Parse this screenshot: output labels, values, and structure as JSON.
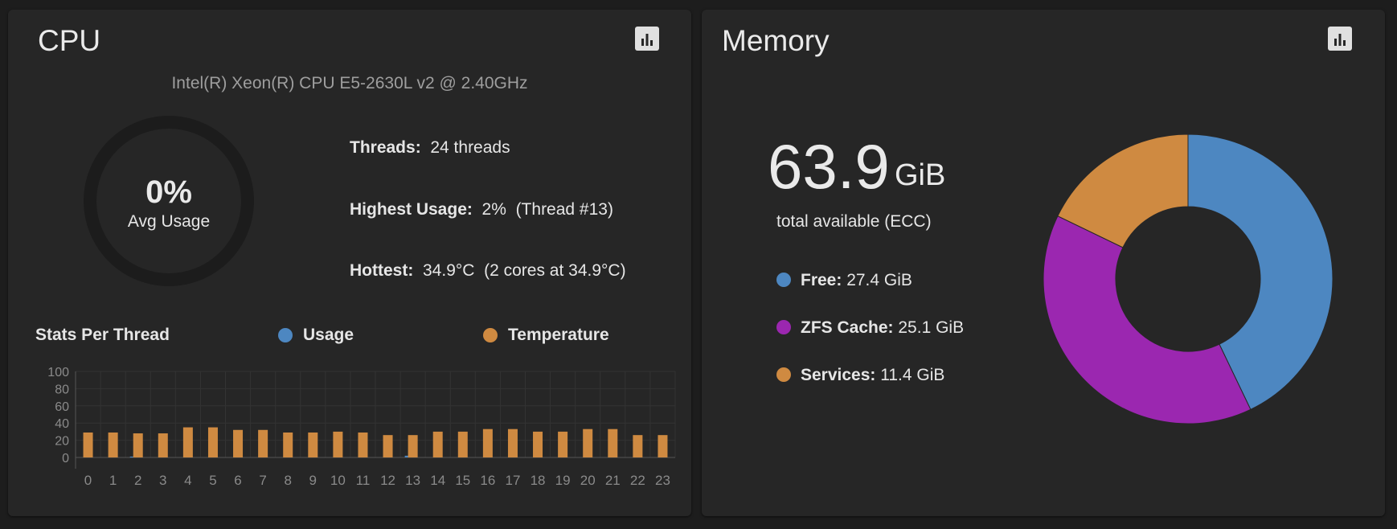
{
  "cpu": {
    "title": "CPU",
    "model": "Intel(R) Xeon(R) CPU E5-2630L v2 @ 2.40GHz",
    "avg_usage_value": "0%",
    "avg_usage_label": "Avg Usage",
    "threads_label": "Threads:",
    "threads_value": "24 threads",
    "highest_label": "Highest Usage:",
    "highest_value": "2%  (Thread #13)",
    "hottest_label": "Hottest:",
    "hottest_value": "34.9°C  (2 cores at 34.9°C)",
    "stats_per_thread_label": "Stats Per Thread",
    "legend_usage": "Usage",
    "legend_temperature": "Temperature"
  },
  "memory": {
    "title": "Memory",
    "total_value": "63.9",
    "total_unit": "GiB",
    "total_caption": "total available (ECC)",
    "legend": [
      {
        "label": "Free:",
        "value": "27.4 GiB",
        "color": "#4d87c1"
      },
      {
        "label": "ZFS Cache:",
        "value": "25.1 GiB",
        "color": "#9b27b0"
      },
      {
        "label": "Services:",
        "value": "11.4 GiB",
        "color": "#cf8a41"
      }
    ]
  },
  "icons": {
    "chart_button": "bar-chart-icon"
  },
  "colors": {
    "usage": "#4d87c1",
    "temperature": "#cf8a41",
    "zfs": "#9b27b0"
  },
  "chart_data": [
    {
      "type": "bar",
      "title": "Stats Per Thread",
      "categories": [
        "0",
        "1",
        "2",
        "3",
        "4",
        "5",
        "6",
        "7",
        "8",
        "9",
        "10",
        "11",
        "12",
        "13",
        "14",
        "15",
        "16",
        "17",
        "18",
        "19",
        "20",
        "21",
        "22",
        "23"
      ],
      "series": [
        {
          "name": "Usage",
          "values": [
            0,
            0,
            1,
            0,
            0,
            0,
            0,
            0,
            0,
            0,
            0,
            0,
            0,
            2,
            0,
            0,
            0,
            0,
            0,
            0,
            0,
            0,
            0,
            0
          ]
        },
        {
          "name": "Temperature",
          "values": [
            29,
            29,
            28,
            28,
            35,
            35,
            32,
            32,
            29,
            29,
            30,
            29,
            26,
            26,
            30,
            30,
            33,
            33,
            30,
            30,
            33,
            33,
            26,
            26
          ]
        }
      ],
      "yticks": [
        0,
        20,
        40,
        60,
        80,
        100
      ],
      "ylim": [
        0,
        100
      ],
      "grid": true
    },
    {
      "type": "pie",
      "categories": [
        "Free",
        "ZFS Cache",
        "Services"
      ],
      "values": [
        27.4,
        25.1,
        11.4
      ],
      "donut": true
    }
  ]
}
